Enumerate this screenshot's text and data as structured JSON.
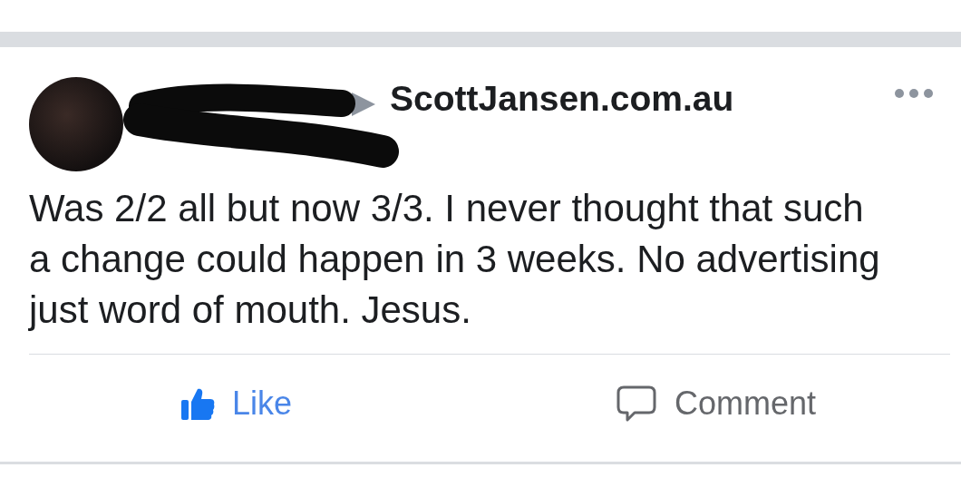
{
  "post": {
    "page_name": "ScottJansen.com.au",
    "text": "Was 2/2 all but now 3/3. I never thought that such a change could happen in 3 weeks. No advertising just word of mouth. Jesus."
  },
  "actions": [
    {
      "kind": "like",
      "label": "Like",
      "selected": true
    },
    {
      "kind": "comment",
      "label": "Comment",
      "selected": false
    }
  ]
}
